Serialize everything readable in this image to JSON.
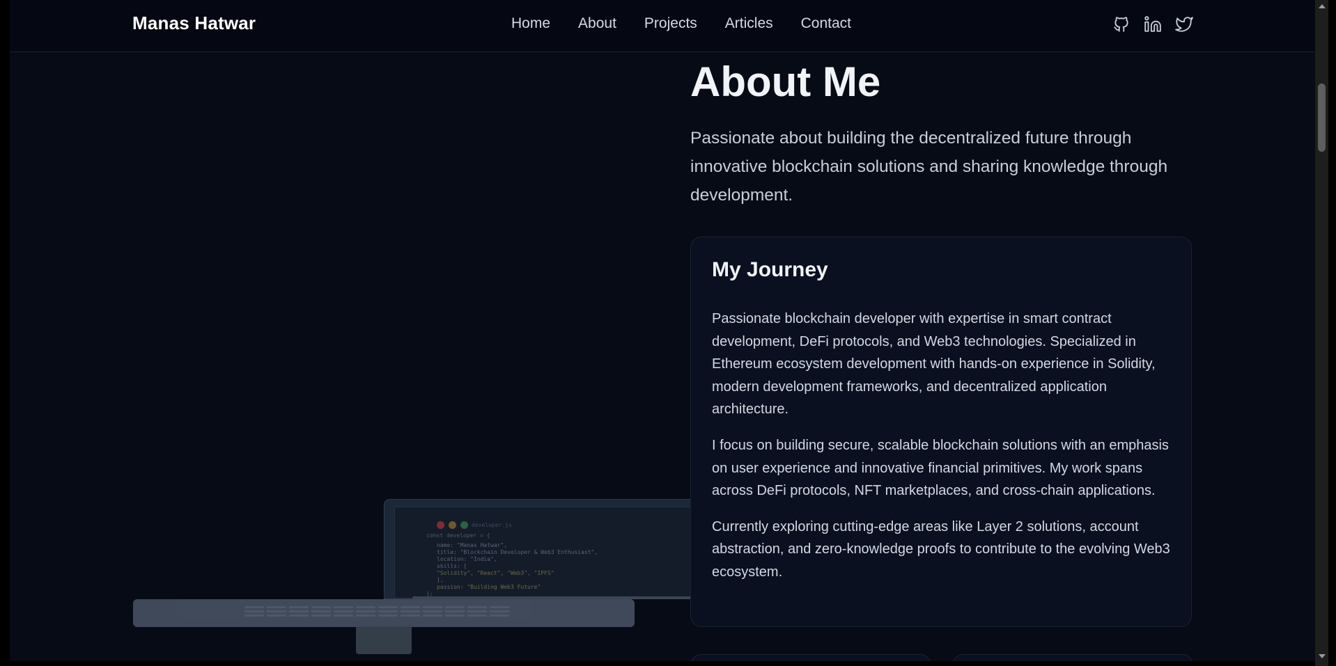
{
  "brand": "Manas Hatwar",
  "nav": {
    "links": [
      "Home",
      "About",
      "Projects",
      "Articles",
      "Contact"
    ]
  },
  "socials": [
    "github-icon",
    "linkedin-icon",
    "twitter-icon"
  ],
  "code_snippet": {
    "header": "developer.js",
    "lines": [
      "const developer = {",
      "  name: \"Manas Hatwar\",",
      "  title: \"Blockchain Developer & Web3 Enthusiast\",",
      "  location: \"India\",",
      "  skills: [",
      "    \"Solidity\", \"React\", \"Web3\", \"IPFS\"",
      "  ],",
      "  passion: \"Building Web3 Future\"",
      "};"
    ]
  },
  "about": {
    "title": "About Me",
    "subtitle": "Passionate about building the decentralized future through innovative blockchain solutions and sharing knowledge through development."
  },
  "journey": {
    "title": "My Journey",
    "paragraphs": [
      "Passionate blockchain developer with expertise in smart contract development, DeFi protocols, and Web3 technologies. Specialized in Ethereum ecosystem development with hands-on experience in Solidity, modern development frameworks, and decentralized application architecture.",
      "I focus on building secure, scalable blockchain solutions with an emphasis on user experience and innovative financial primitives. My work spans across DeFi protocols, NFT marketplaces, and cross-chain applications.",
      "Currently exploring cutting-edge areas like Layer 2 solutions, account abstraction, and zero-knowledge proofs to contribute to the evolving Web3 ecosystem."
    ]
  },
  "colors": {
    "background": "#070b16",
    "accent_text": "#f1f3f8",
    "muted_text": "#c8cedb"
  }
}
